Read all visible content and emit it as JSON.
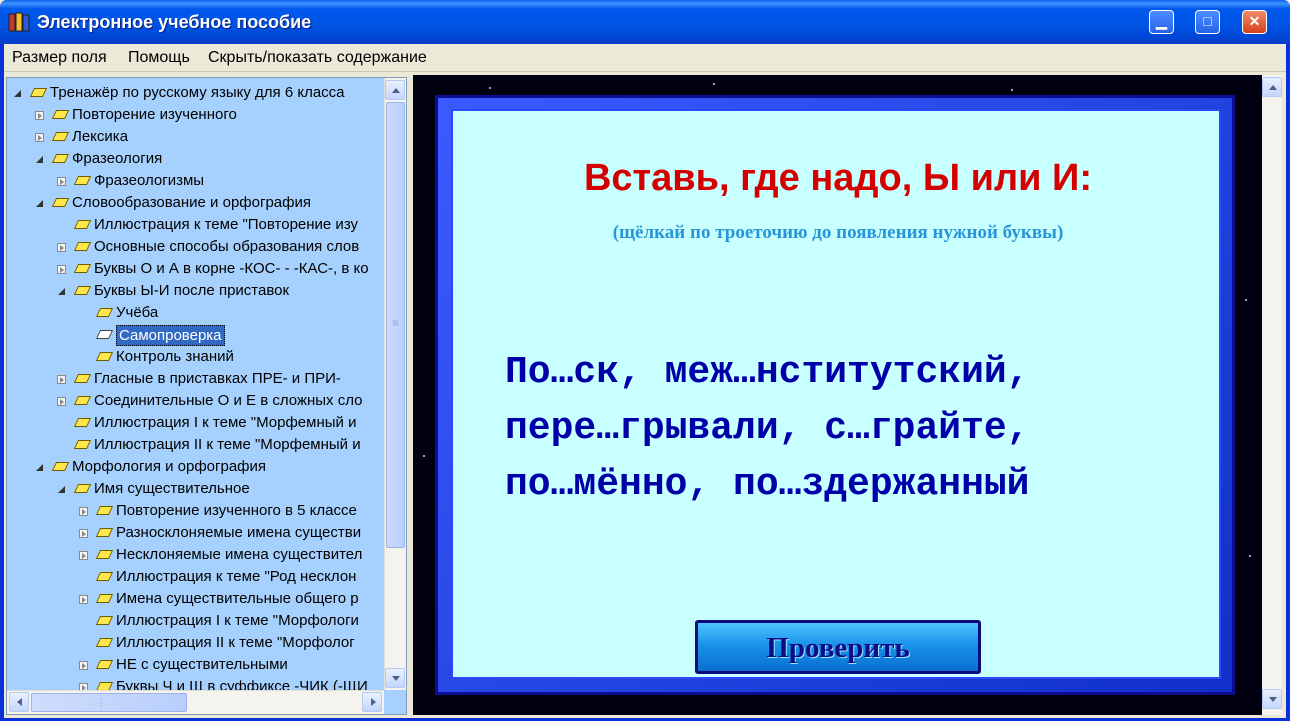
{
  "window": {
    "title": "Электронное учебное пособие"
  },
  "menu": {
    "field_size": "Размер поля",
    "help": "Помощь",
    "toggle_contents": "Скрыть/показать содержание"
  },
  "tree": [
    {
      "label": "Тренажёр по русскому языку для 6 класса",
      "level": 0,
      "exp": "open"
    },
    {
      "label": "Повторение изученного",
      "level": 1,
      "exp": "closed"
    },
    {
      "label": "Лексика",
      "level": 1,
      "exp": "closed"
    },
    {
      "label": "Фразеология",
      "level": 1,
      "exp": "open"
    },
    {
      "label": "Фразеологизмы",
      "level": 2,
      "exp": "closed"
    },
    {
      "label": "Словообразование и орфография",
      "level": 1,
      "exp": "open"
    },
    {
      "label": "Иллюстрация к теме \"Повторение изу",
      "level": 2,
      "exp": "none"
    },
    {
      "label": "Основные способы образования слов",
      "level": 2,
      "exp": "closed"
    },
    {
      "label": "Буквы О и А в корне -КОС- - -КАС-, в ко",
      "level": 2,
      "exp": "closed"
    },
    {
      "label": "Буквы Ы-И после приставок",
      "level": 2,
      "exp": "open"
    },
    {
      "label": "Учёба",
      "level": 3,
      "exp": "none"
    },
    {
      "label": "Самопроверка",
      "level": 3,
      "exp": "none",
      "selected": true
    },
    {
      "label": "Контроль знаний",
      "level": 3,
      "exp": "none"
    },
    {
      "label": "Гласные в приставках ПРЕ- и ПРИ-",
      "level": 2,
      "exp": "closed"
    },
    {
      "label": "Соединительные О и Е в сложных сло",
      "level": 2,
      "exp": "closed"
    },
    {
      "label": "Иллюстрация I к теме \"Морфемный и",
      "level": 2,
      "exp": "none"
    },
    {
      "label": "Иллюстрация II к теме \"Морфемный и",
      "level": 2,
      "exp": "none"
    },
    {
      "label": "Морфология и орфография",
      "level": 1,
      "exp": "open"
    },
    {
      "label": "Имя существительное",
      "level": 2,
      "exp": "open"
    },
    {
      "label": "Повторение изученного в 5 классе",
      "level": 3,
      "exp": "closed"
    },
    {
      "label": "Разносклоняемые имена существи",
      "level": 3,
      "exp": "closed"
    },
    {
      "label": "Несклоняемые имена существител",
      "level": 3,
      "exp": "closed"
    },
    {
      "label": "Иллюстрация к теме \"Род несклон",
      "level": 3,
      "exp": "none"
    },
    {
      "label": "Имена существительные общего р",
      "level": 3,
      "exp": "closed"
    },
    {
      "label": "Иллюстрация I к теме \"Морфологи",
      "level": 3,
      "exp": "none"
    },
    {
      "label": "Иллюстрация II к теме \"Морфолог",
      "level": 3,
      "exp": "none"
    },
    {
      "label": "НЕ с существительными",
      "level": 3,
      "exp": "closed"
    },
    {
      "label": "Буквы Ч и Щ в суффиксе -ЧИК (-ЩИ",
      "level": 3,
      "exp": "closed"
    }
  ],
  "exercise": {
    "title": "Вставь, где надо, Ы или И:",
    "subtitle": "(щёлкай по троеточию до появления нужной буквы)",
    "lines": [
      "По…ск, меж…нститутский,",
      "пере…грывали, с…грайте,",
      "по…мённо, по…здержанный"
    ],
    "check_button": "Проверить"
  },
  "colors": {
    "title_red": "#d40000",
    "subtitle_blue": "#2895d8",
    "exercise_text": "#0000a8",
    "tree_bg": "#a6d1fe",
    "card_bg": "#c8ffff"
  }
}
